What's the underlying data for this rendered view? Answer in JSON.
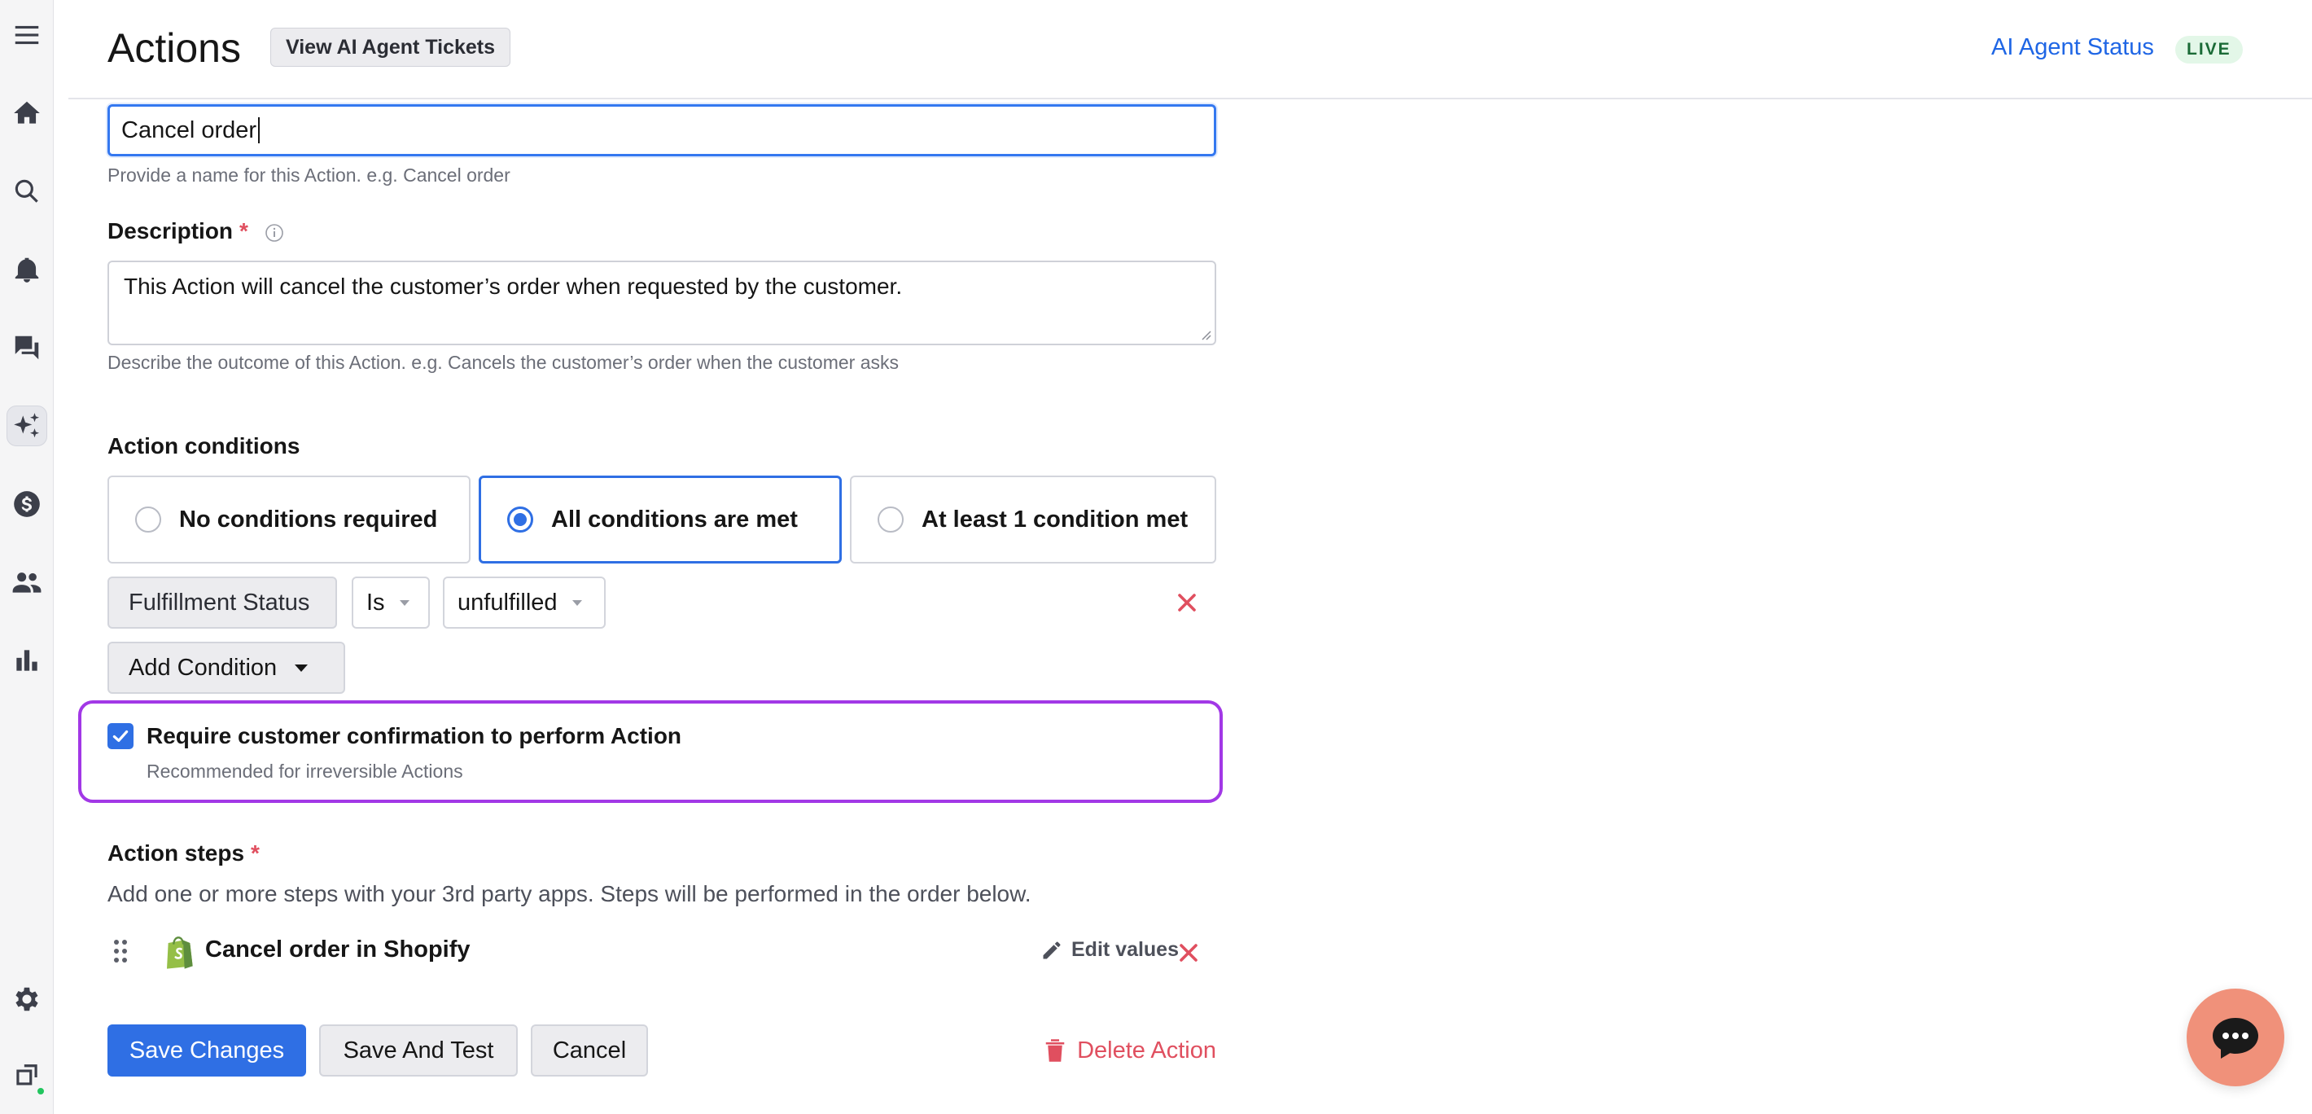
{
  "header": {
    "title": "Actions",
    "view_tickets_label": "View AI Agent Tickets",
    "agent_status_label": "AI Agent Status",
    "live_badge": "LIVE"
  },
  "nav": {
    "items": [
      "menu-icon",
      "home-icon",
      "search-icon",
      "bell-icon",
      "chat-icon",
      "ai-sparkle-icon",
      "dollar-icon",
      "users-icon",
      "bar-chart-icon",
      "gear-icon",
      "workspace-icon"
    ],
    "active": "ai-sparkle-icon"
  },
  "form": {
    "name_value": "Cancel order",
    "name_hint": "Provide a name for this Action. e.g. Cancel order",
    "description_label": "Description",
    "required_mark": "*",
    "description_value": "This Action will cancel the customer’s order when requested by the customer.",
    "description_hint": "Describe the outcome of this Action. e.g. Cancels the customer’s order when the customer asks"
  },
  "conditions": {
    "label": "Action conditions",
    "options": [
      "No conditions required",
      "All conditions are met",
      "At least 1 condition met"
    ],
    "selected": "All conditions are met",
    "rule": {
      "field": "Fulfillment Status",
      "operator": "Is",
      "value": "unfulfilled"
    },
    "add_label": "Add Condition"
  },
  "confirmation": {
    "checked": true,
    "title": "Require customer confirmation to perform Action",
    "subtitle": "Recommended for irreversible Actions"
  },
  "steps": {
    "label": "Action steps",
    "required_mark": "*",
    "description": "Add one or more steps with your 3rd party apps. Steps will be performed in the order below.",
    "items": [
      {
        "title": "Cancel order in Shopify",
        "edit_label": "Edit values"
      }
    ]
  },
  "footer": {
    "save_label": "Save Changes",
    "save_test_label": "Save And Test",
    "cancel_label": "Cancel",
    "delete_label": "Delete Action"
  },
  "colors": {
    "primary": "#2f6fe4",
    "danger": "#e04f5f",
    "highlight": "#a238e6",
    "live_bg": "#e3f7e8",
    "chat_fab": "#f0917a"
  }
}
